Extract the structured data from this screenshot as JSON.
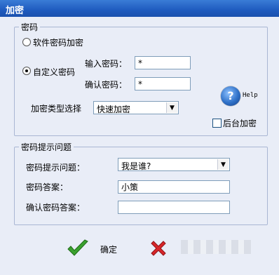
{
  "window": {
    "title": "加密"
  },
  "password_group": {
    "title": "密码",
    "software_encrypt_label": "软件密码加密",
    "custom_password_label": "自定义密码",
    "input_password_label": "输入密码：",
    "input_password_value": "*",
    "confirm_password_label": "确认密码：",
    "confirm_password_value": "*",
    "encrypt_type_label": "加密类型选择",
    "encrypt_type_value": "快速加密",
    "help_label": "Help",
    "background_encrypt_label": "后台加密"
  },
  "hint_group": {
    "title": "密码提示问题",
    "question_label": "密码提示问题：",
    "question_value": "我是谁?",
    "answer_label": "密码答案：",
    "answer_value": "小策",
    "confirm_answer_label": "确认密码答案：",
    "confirm_answer_value": ""
  },
  "actions": {
    "ok_label": "确定"
  }
}
